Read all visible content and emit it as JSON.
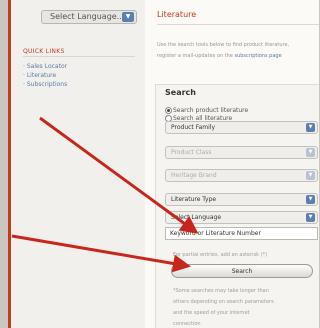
{
  "sidebar": {
    "language_select": "Select Language...",
    "quick_links_title": "QUICK LINKS",
    "links": [
      "Sales Locator",
      "Literature",
      "Subscriptions"
    ]
  },
  "main": {
    "title": "Literature",
    "intro_lines": [
      "Use the search tools below to find product literature,",
      "register a mail-updates on the "
    ],
    "intro_link": "subscriptions page"
  },
  "search": {
    "heading": "Search",
    "radio_products": "Search product literature",
    "radio_all": "Search all literature",
    "product_family": "Product Family",
    "product_class": "Product Class",
    "heritage_brand": "Heritage Brand",
    "literature_type": "Literature Type",
    "select_language": "Select Language",
    "keyword_placeholder": "Keyword or Literature Number",
    "hint": "For partial entries, add an asterisk (*)",
    "button": "Search",
    "note_lines": [
      "*Some searches may take longer than",
      "others depending on search parameters",
      "and the speed of your internet",
      "connection"
    ]
  },
  "colors": {
    "accent": "#c23a20",
    "link": "#5c7aa6",
    "dropdown_button": "#5d7fb0"
  }
}
